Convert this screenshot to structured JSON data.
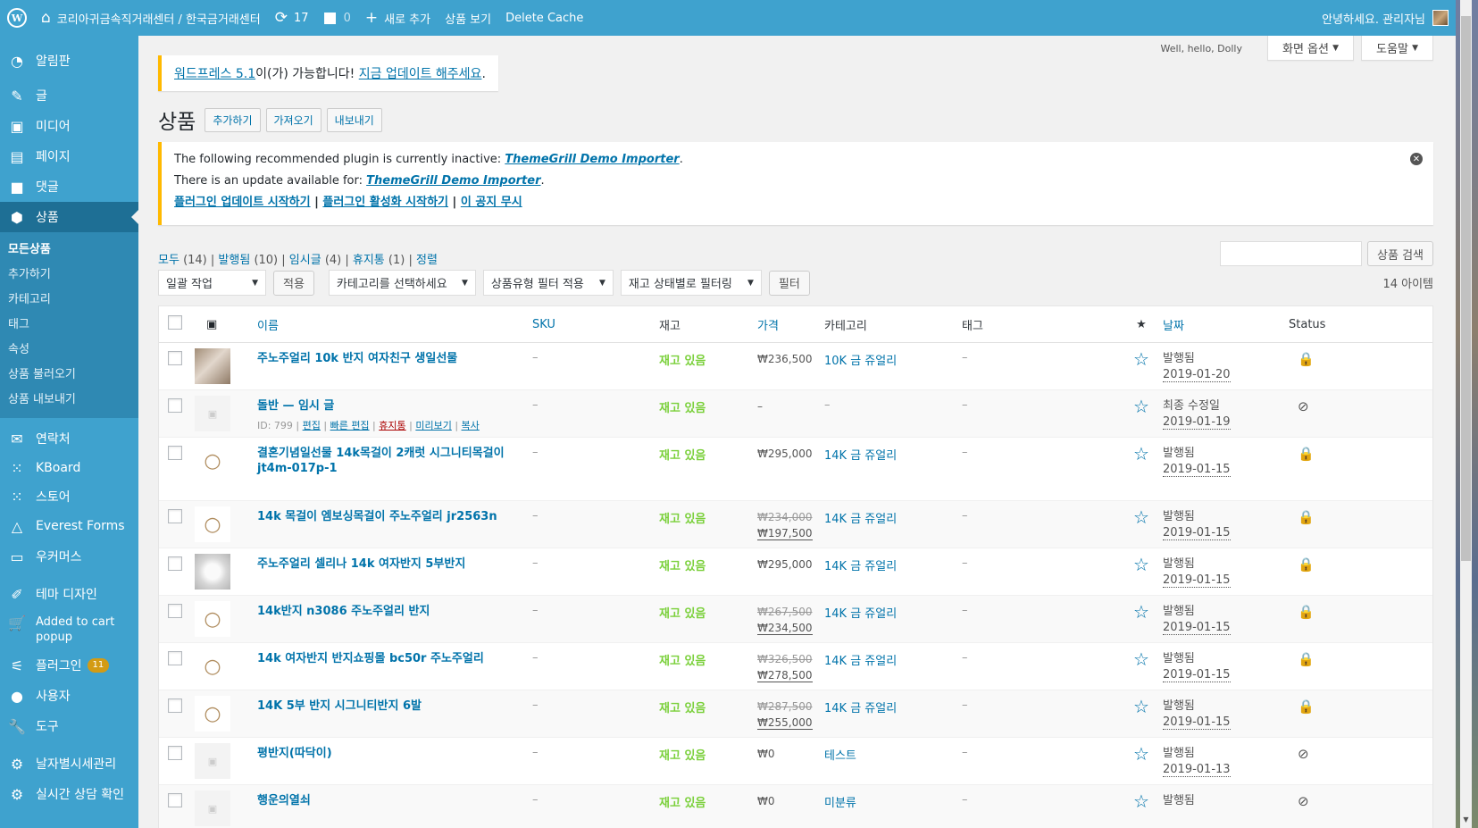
{
  "adminbar": {
    "site_title": "코리아귀금속직거래센터 / 한국금거래센터",
    "updates_count": "17",
    "comments_count": "0",
    "new_label": "새로 추가",
    "view_products": "상품 보기",
    "delete_cache": "Delete Cache",
    "greeting": "안녕하세요. 관리자님"
  },
  "sidebar": {
    "items": [
      {
        "label": "알림판",
        "icon": "dashboard-icon"
      },
      {
        "label": "글",
        "icon": "pin-icon"
      },
      {
        "label": "미디어",
        "icon": "media-icon"
      },
      {
        "label": "페이지",
        "icon": "page-icon"
      },
      {
        "label": "댓글",
        "icon": "comment-icon"
      },
      {
        "label": "상품",
        "icon": "product-icon"
      }
    ],
    "submenu": [
      "모든상품",
      "추가하기",
      "카테고리",
      "태그",
      "속성",
      "상품 불러오기",
      "상품 내보내기"
    ],
    "items2": [
      {
        "label": "연락처",
        "icon": "mail-icon"
      },
      {
        "label": "KBoard",
        "icon": "kboard-icon"
      },
      {
        "label": "스토어",
        "icon": "store-icon"
      },
      {
        "label": "Everest Forms",
        "icon": "forms-icon"
      },
      {
        "label": "우커머스",
        "icon": "woo-icon"
      },
      {
        "label": "테마 디자인",
        "icon": "brush-icon"
      },
      {
        "label": "Added to cart popup",
        "icon": "cart-icon"
      },
      {
        "label": "플러그인",
        "icon": "plugin-icon",
        "badge": "11"
      },
      {
        "label": "사용자",
        "icon": "user-icon"
      },
      {
        "label": "도구",
        "icon": "tool-icon"
      },
      {
        "label": "날자별시세관리",
        "icon": "gear-icon"
      },
      {
        "label": "실시간 상담 확인",
        "icon": "gear-icon"
      }
    ]
  },
  "screen_meta": {
    "hello_dolly": "Well, hello, Dolly",
    "screen_options": "화면 옵션",
    "help": "도움말"
  },
  "update_nag": {
    "version_link": "워드프레스 5.1",
    "middle": "이(가) 가능합니다! ",
    "update_link": "지금 업데이트 해주세요",
    "end": "."
  },
  "page": {
    "title": "상품",
    "add_new": "추가하기",
    "import": "가져오기",
    "export": "내보내기"
  },
  "notice": {
    "line1_text": "The following recommended plugin is currently inactive: ",
    "line1_link": "ThemeGrill Demo Importer",
    "line2_text": "There is an update available for: ",
    "line2_link": "ThemeGrill Demo Importer",
    "action1": "플러그인 업데이트 시작하기",
    "action2": "플러그인 활성화 시작하기",
    "action3": "이 공지 무시",
    "sep": " | ",
    "period": "."
  },
  "filters": {
    "all": "모두",
    "all_count": "(14)",
    "published": "발행됨",
    "published_count": "(10)",
    "draft": "임시글",
    "draft_count": "(4)",
    "trash": "휴지통",
    "trash_count": "(1)",
    "sort": "정렬",
    "sep": " | "
  },
  "search": {
    "button": "상품 검색",
    "value": ""
  },
  "tablenav": {
    "bulk": "일괄 작업",
    "apply": "적용",
    "category": "카테고리를 선택하세요",
    "type": "상품유형 필터 적용",
    "stock": "재고 상태별로 필터링",
    "filter": "필터",
    "count": "14 아이템"
  },
  "columns": {
    "name": "이름",
    "sku": "SKU",
    "stock": "재고",
    "price": "가격",
    "category": "카테고리",
    "tag": "태그",
    "date": "날짜",
    "status": "Status"
  },
  "rows": [
    {
      "name": "주노주얼리 10k 반지 여자친구 생일선물",
      "sku": "–",
      "stock": "재고 있음",
      "price": "₩236,500",
      "old_price": "",
      "category": "10K 금 쥬얼리",
      "tag": "–",
      "date_label": "발행됨",
      "date": "2019-01-20",
      "status": "lock-icon",
      "thumb": "photo-ring"
    },
    {
      "name": "돌반 — 임시 글",
      "sku": "–",
      "stock": "재고 있음",
      "price": "–",
      "old_price": "",
      "category": "–",
      "tag": "–",
      "date_label": "최종 수정일",
      "date": "2019-01-19",
      "status": "hidden-icon",
      "thumb": "placeholder",
      "rowactions": {
        "id": "ID: 799",
        "edit": "편집",
        "quick": "빠른 편집",
        "trash": "휴지통",
        "preview": "미리보기",
        "copy": "복사"
      }
    },
    {
      "name": "결혼기념일선물 14k목걸이 2캐럿 시그니티목걸이 jt4m-017p-1",
      "sku": "–",
      "stock": "재고 있음",
      "price": "₩295,000",
      "old_price": "",
      "category": "14K 금 쥬얼리",
      "tag": "–",
      "date_label": "발행됨",
      "date": "2019-01-15",
      "status": "lock-icon",
      "thumb": "line"
    },
    {
      "name": "14k 목걸이 엠보싱목걸이 주노주얼리 jr2563n",
      "sku": "–",
      "stock": "재고 있음",
      "price": "₩197,500",
      "old_price": "₩234,000",
      "category": "14K 금 쥬얼리",
      "tag": "–",
      "date_label": "발행됨",
      "date": "2019-01-15",
      "status": "lock-icon",
      "thumb": "line"
    },
    {
      "name": "주노주얼리 셀리나 14k 여자반지 5부반지",
      "sku": "–",
      "stock": "재고 있음",
      "price": "₩295,000",
      "old_price": "",
      "category": "14K 금 쥬얼리",
      "tag": "–",
      "date_label": "발행됨",
      "date": "2019-01-15",
      "status": "lock-icon",
      "thumb": "photo-white"
    },
    {
      "name": "14k반지 n3086 주노주얼리 반지",
      "sku": "–",
      "stock": "재고 있음",
      "price": "₩234,500",
      "old_price": "₩267,500",
      "category": "14K 금 쥬얼리",
      "tag": "–",
      "date_label": "발행됨",
      "date": "2019-01-15",
      "status": "lock-icon",
      "thumb": "line"
    },
    {
      "name": "14k 여자반지 반지쇼핑몰 bc50r 주노주얼리",
      "sku": "–",
      "stock": "재고 있음",
      "price": "₩278,500",
      "old_price": "₩326,500",
      "category": "14K 금 쥬얼리",
      "tag": "–",
      "date_label": "발행됨",
      "date": "2019-01-15",
      "status": "lock-icon",
      "thumb": "line"
    },
    {
      "name": "14K 5부 반지 시그니티반지 6발",
      "sku": "–",
      "stock": "재고 있음",
      "price": "₩255,000",
      "old_price": "₩287,500",
      "category": "14K 금 쥬얼리",
      "tag": "–",
      "date_label": "발행됨",
      "date": "2019-01-15",
      "status": "lock-icon",
      "thumb": "line"
    },
    {
      "name": "평반지(따닥이)",
      "sku": "–",
      "stock": "재고 있음",
      "price": "₩0",
      "old_price": "",
      "category": "테스트",
      "tag": "–",
      "date_label": "발행됨",
      "date": "2019-01-13",
      "status": "hidden-icon",
      "thumb": "placeholder"
    },
    {
      "name": "행운의열쇠",
      "sku": "–",
      "stock": "재고 있음",
      "price": "₩0",
      "old_price": "",
      "category": "미분류",
      "tag": "–",
      "date_label": "발행됨",
      "date": "",
      "status": "hidden-icon",
      "thumb": "placeholder"
    }
  ]
}
